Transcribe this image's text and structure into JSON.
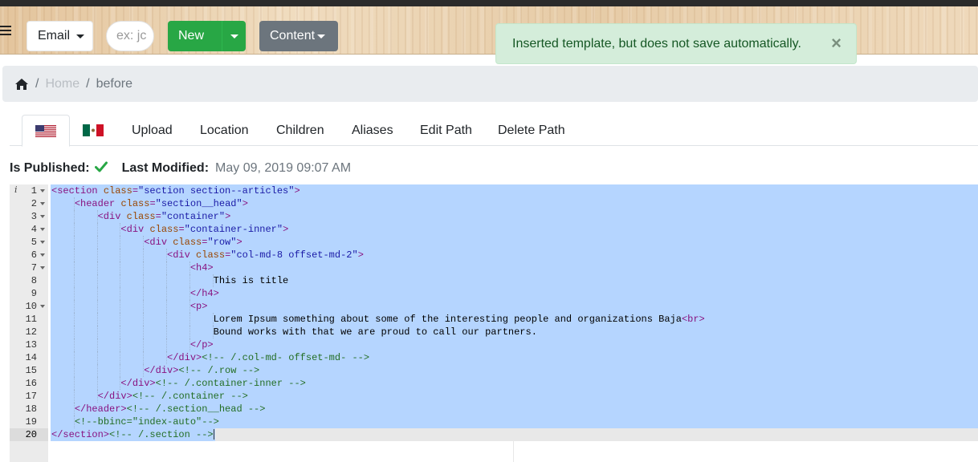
{
  "navbar": {
    "email_label": "Email",
    "search_placeholder": "ex: jc",
    "new_label": "New",
    "content_label": "Content"
  },
  "alert": {
    "message": "Inserted template, but does not save automatically.",
    "close_glyph": "×",
    "color": "#d4edda"
  },
  "breadcrumb": {
    "home_icon": "home-icon",
    "items": [
      "Home",
      "before"
    ],
    "separator": "/"
  },
  "tabs": {
    "flags": [
      "us-flag-icon",
      "mexico-flag-icon"
    ],
    "items": [
      "Upload",
      "Location",
      "Children",
      "Aliases",
      "Edit Path",
      "Delete Path"
    ]
  },
  "status": {
    "published_label": "Is Published:",
    "published": true,
    "modified_label": "Last Modified:",
    "modified_value": "May 09, 2019 09:07 AM"
  },
  "editor": {
    "active_line": 20,
    "info_marker": "i",
    "fold_lines": [
      1,
      2,
      3,
      4,
      5,
      6,
      7,
      10
    ],
    "lines": [
      {
        "n": "1",
        "indent": 0,
        "tokens": [
          [
            "tag",
            "<section"
          ],
          [
            "txt",
            " "
          ],
          [
            "attr",
            "class"
          ],
          [
            "tag",
            "="
          ],
          [
            "val",
            "\"section section--articles\""
          ],
          [
            "tag",
            ">"
          ]
        ]
      },
      {
        "n": "2",
        "indent": 1,
        "tokens": [
          [
            "tag",
            "<header"
          ],
          [
            "txt",
            " "
          ],
          [
            "attr",
            "class"
          ],
          [
            "tag",
            "="
          ],
          [
            "val",
            "\"section__head\""
          ],
          [
            "tag",
            ">"
          ]
        ]
      },
      {
        "n": "3",
        "indent": 2,
        "tokens": [
          [
            "tag",
            "<div"
          ],
          [
            "txt",
            " "
          ],
          [
            "attr",
            "class"
          ],
          [
            "tag",
            "="
          ],
          [
            "val",
            "\"container\""
          ],
          [
            "tag",
            ">"
          ]
        ]
      },
      {
        "n": "4",
        "indent": 3,
        "tokens": [
          [
            "tag",
            "<div"
          ],
          [
            "txt",
            " "
          ],
          [
            "attr",
            "class"
          ],
          [
            "tag",
            "="
          ],
          [
            "val",
            "\"container-inner\""
          ],
          [
            "tag",
            ">"
          ]
        ]
      },
      {
        "n": "5",
        "indent": 4,
        "tokens": [
          [
            "tag",
            "<div"
          ],
          [
            "txt",
            " "
          ],
          [
            "attr",
            "class"
          ],
          [
            "tag",
            "="
          ],
          [
            "val",
            "\"row\""
          ],
          [
            "tag",
            ">"
          ]
        ]
      },
      {
        "n": "6",
        "indent": 5,
        "tokens": [
          [
            "tag",
            "<div"
          ],
          [
            "txt",
            " "
          ],
          [
            "attr",
            "class"
          ],
          [
            "tag",
            "="
          ],
          [
            "val",
            "\"col-md-8 offset-md-2\""
          ],
          [
            "tag",
            ">"
          ]
        ]
      },
      {
        "n": "7",
        "indent": 6,
        "tokens": [
          [
            "tag",
            "<h4>"
          ]
        ]
      },
      {
        "n": "8",
        "indent": 7,
        "tokens": [
          [
            "txt",
            "This is title"
          ]
        ]
      },
      {
        "n": "9",
        "indent": 6,
        "tokens": [
          [
            "tag",
            "</h4>"
          ]
        ]
      },
      {
        "n": "10",
        "indent": 6,
        "tokens": [
          [
            "tag",
            "<p>"
          ]
        ]
      },
      {
        "n": "11",
        "indent": 7,
        "tokens": [
          [
            "txt",
            "Lorem Ipsum something about some of the interesting people and organizations Baja"
          ],
          [
            "tag",
            "<br>"
          ]
        ]
      },
      {
        "n": "12",
        "indent": 7,
        "tokens": [
          [
            "txt",
            "Bound works with that we are proud to call our partners."
          ]
        ]
      },
      {
        "n": "13",
        "indent": 6,
        "tokens": [
          [
            "tag",
            "</p>"
          ]
        ]
      },
      {
        "n": "14",
        "indent": 5,
        "tokens": [
          [
            "tag",
            "</div>"
          ],
          [
            "comment",
            "<!-- /.col-md- offset-md- -->"
          ]
        ]
      },
      {
        "n": "15",
        "indent": 4,
        "tokens": [
          [
            "tag",
            "</div>"
          ],
          [
            "comment",
            "<!-- /.row -->"
          ]
        ]
      },
      {
        "n": "16",
        "indent": 3,
        "tokens": [
          [
            "tag",
            "</div>"
          ],
          [
            "comment",
            "<!-- /.container-inner -->"
          ]
        ]
      },
      {
        "n": "17",
        "indent": 2,
        "tokens": [
          [
            "tag",
            "</div>"
          ],
          [
            "comment",
            "<!-- /.container -->"
          ]
        ]
      },
      {
        "n": "18",
        "indent": 1,
        "tokens": [
          [
            "tag",
            "</header>"
          ],
          [
            "comment",
            "<!-- /.section__head -->"
          ]
        ]
      },
      {
        "n": "19",
        "indent": 1,
        "tokens": [
          [
            "comment",
            "<!--bbinc=\"index-auto\"-->"
          ]
        ]
      },
      {
        "n": "20",
        "indent": 0,
        "tokens": [
          [
            "tag",
            "</section>"
          ],
          [
            "comment",
            "<!-- /.section -->"
          ]
        ]
      }
    ]
  }
}
